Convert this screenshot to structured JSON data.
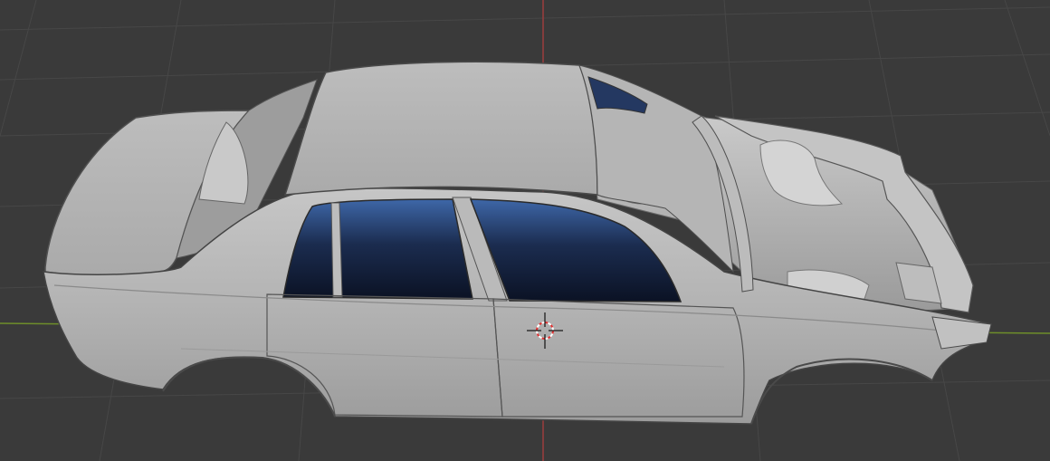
{
  "viewport": {
    "mode": "3D viewport",
    "background_color": "#3a3a3a",
    "grid_color": "#4a4a4a",
    "x_axis_color": "#8a3a3a",
    "y_axis_color": "#6a8a2a",
    "object": "car-body-model",
    "object_color": "#b9b9b9",
    "glass_color": "#1c2c4e",
    "cursor": "3d-cursor-icon"
  }
}
